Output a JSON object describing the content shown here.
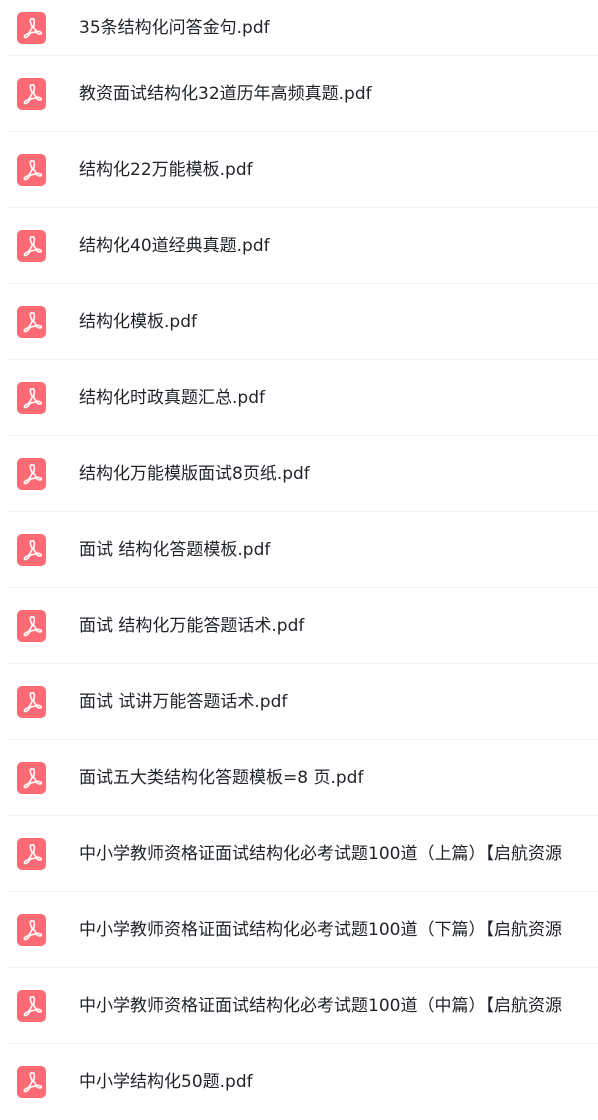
{
  "file_list": {
    "icon": "pdf-file-icon",
    "icon_color": "#ff6b74",
    "items": [
      {
        "name": "35条结构化问答金句.pdf"
      },
      {
        "name": "教资面试结构化32道历年高频真题.pdf"
      },
      {
        "name": "结构化22万能模板.pdf"
      },
      {
        "name": "结构化40道经典真题.pdf"
      },
      {
        "name": "结构化模板.pdf"
      },
      {
        "name": "结构化时政真题汇总.pdf"
      },
      {
        "name": "结构化万能模版面试8页纸.pdf"
      },
      {
        "name": "面试 结构化答题模板.pdf"
      },
      {
        "name": "面试 结构化万能答题话术.pdf"
      },
      {
        "name": "面试 试讲万能答题话术.pdf"
      },
      {
        "name": "面试五大类结构化答题模板=8 页.pdf"
      },
      {
        "name": "中小学教师资格证面试结构化必考试题100道（上篇）【启航资源"
      },
      {
        "name": "中小学教师资格证面试结构化必考试题100道（下篇）【启航资源"
      },
      {
        "name": "中小学教师资格证面试结构化必考试题100道（中篇）【启航资源"
      },
      {
        "name": "中小学结构化50题.pdf"
      }
    ]
  }
}
